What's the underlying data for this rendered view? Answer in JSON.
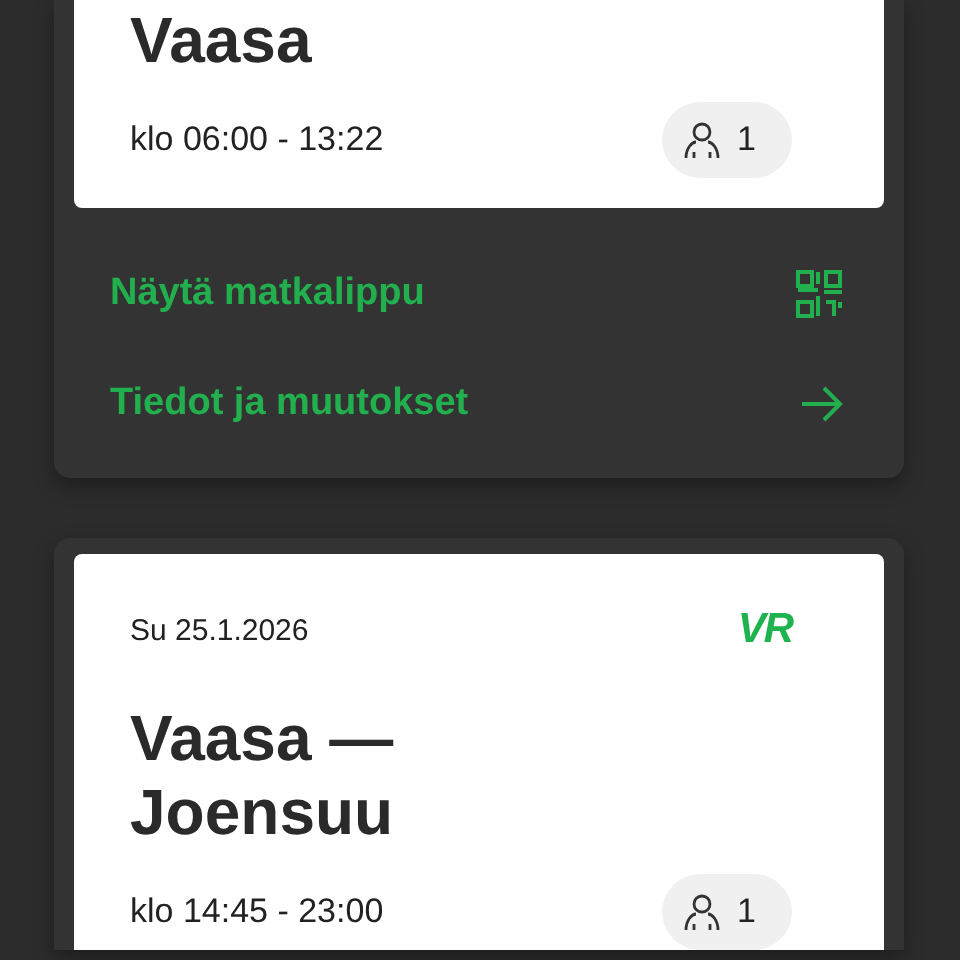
{
  "trips": [
    {
      "title": "Vaasa",
      "time": "klo 06:00 - 13:22",
      "passengers": "1",
      "actions": [
        {
          "label": "Näytä matkalippu",
          "kind": "qr"
        },
        {
          "label": "Tiedot ja muutokset",
          "kind": "arrow"
        }
      ]
    },
    {
      "date": "Su 25.1.2026",
      "logo": "VR",
      "title": "Vaasa —\nJoensuu",
      "time": "klo 14:45 - 23:00",
      "passengers": "1"
    }
  ]
}
